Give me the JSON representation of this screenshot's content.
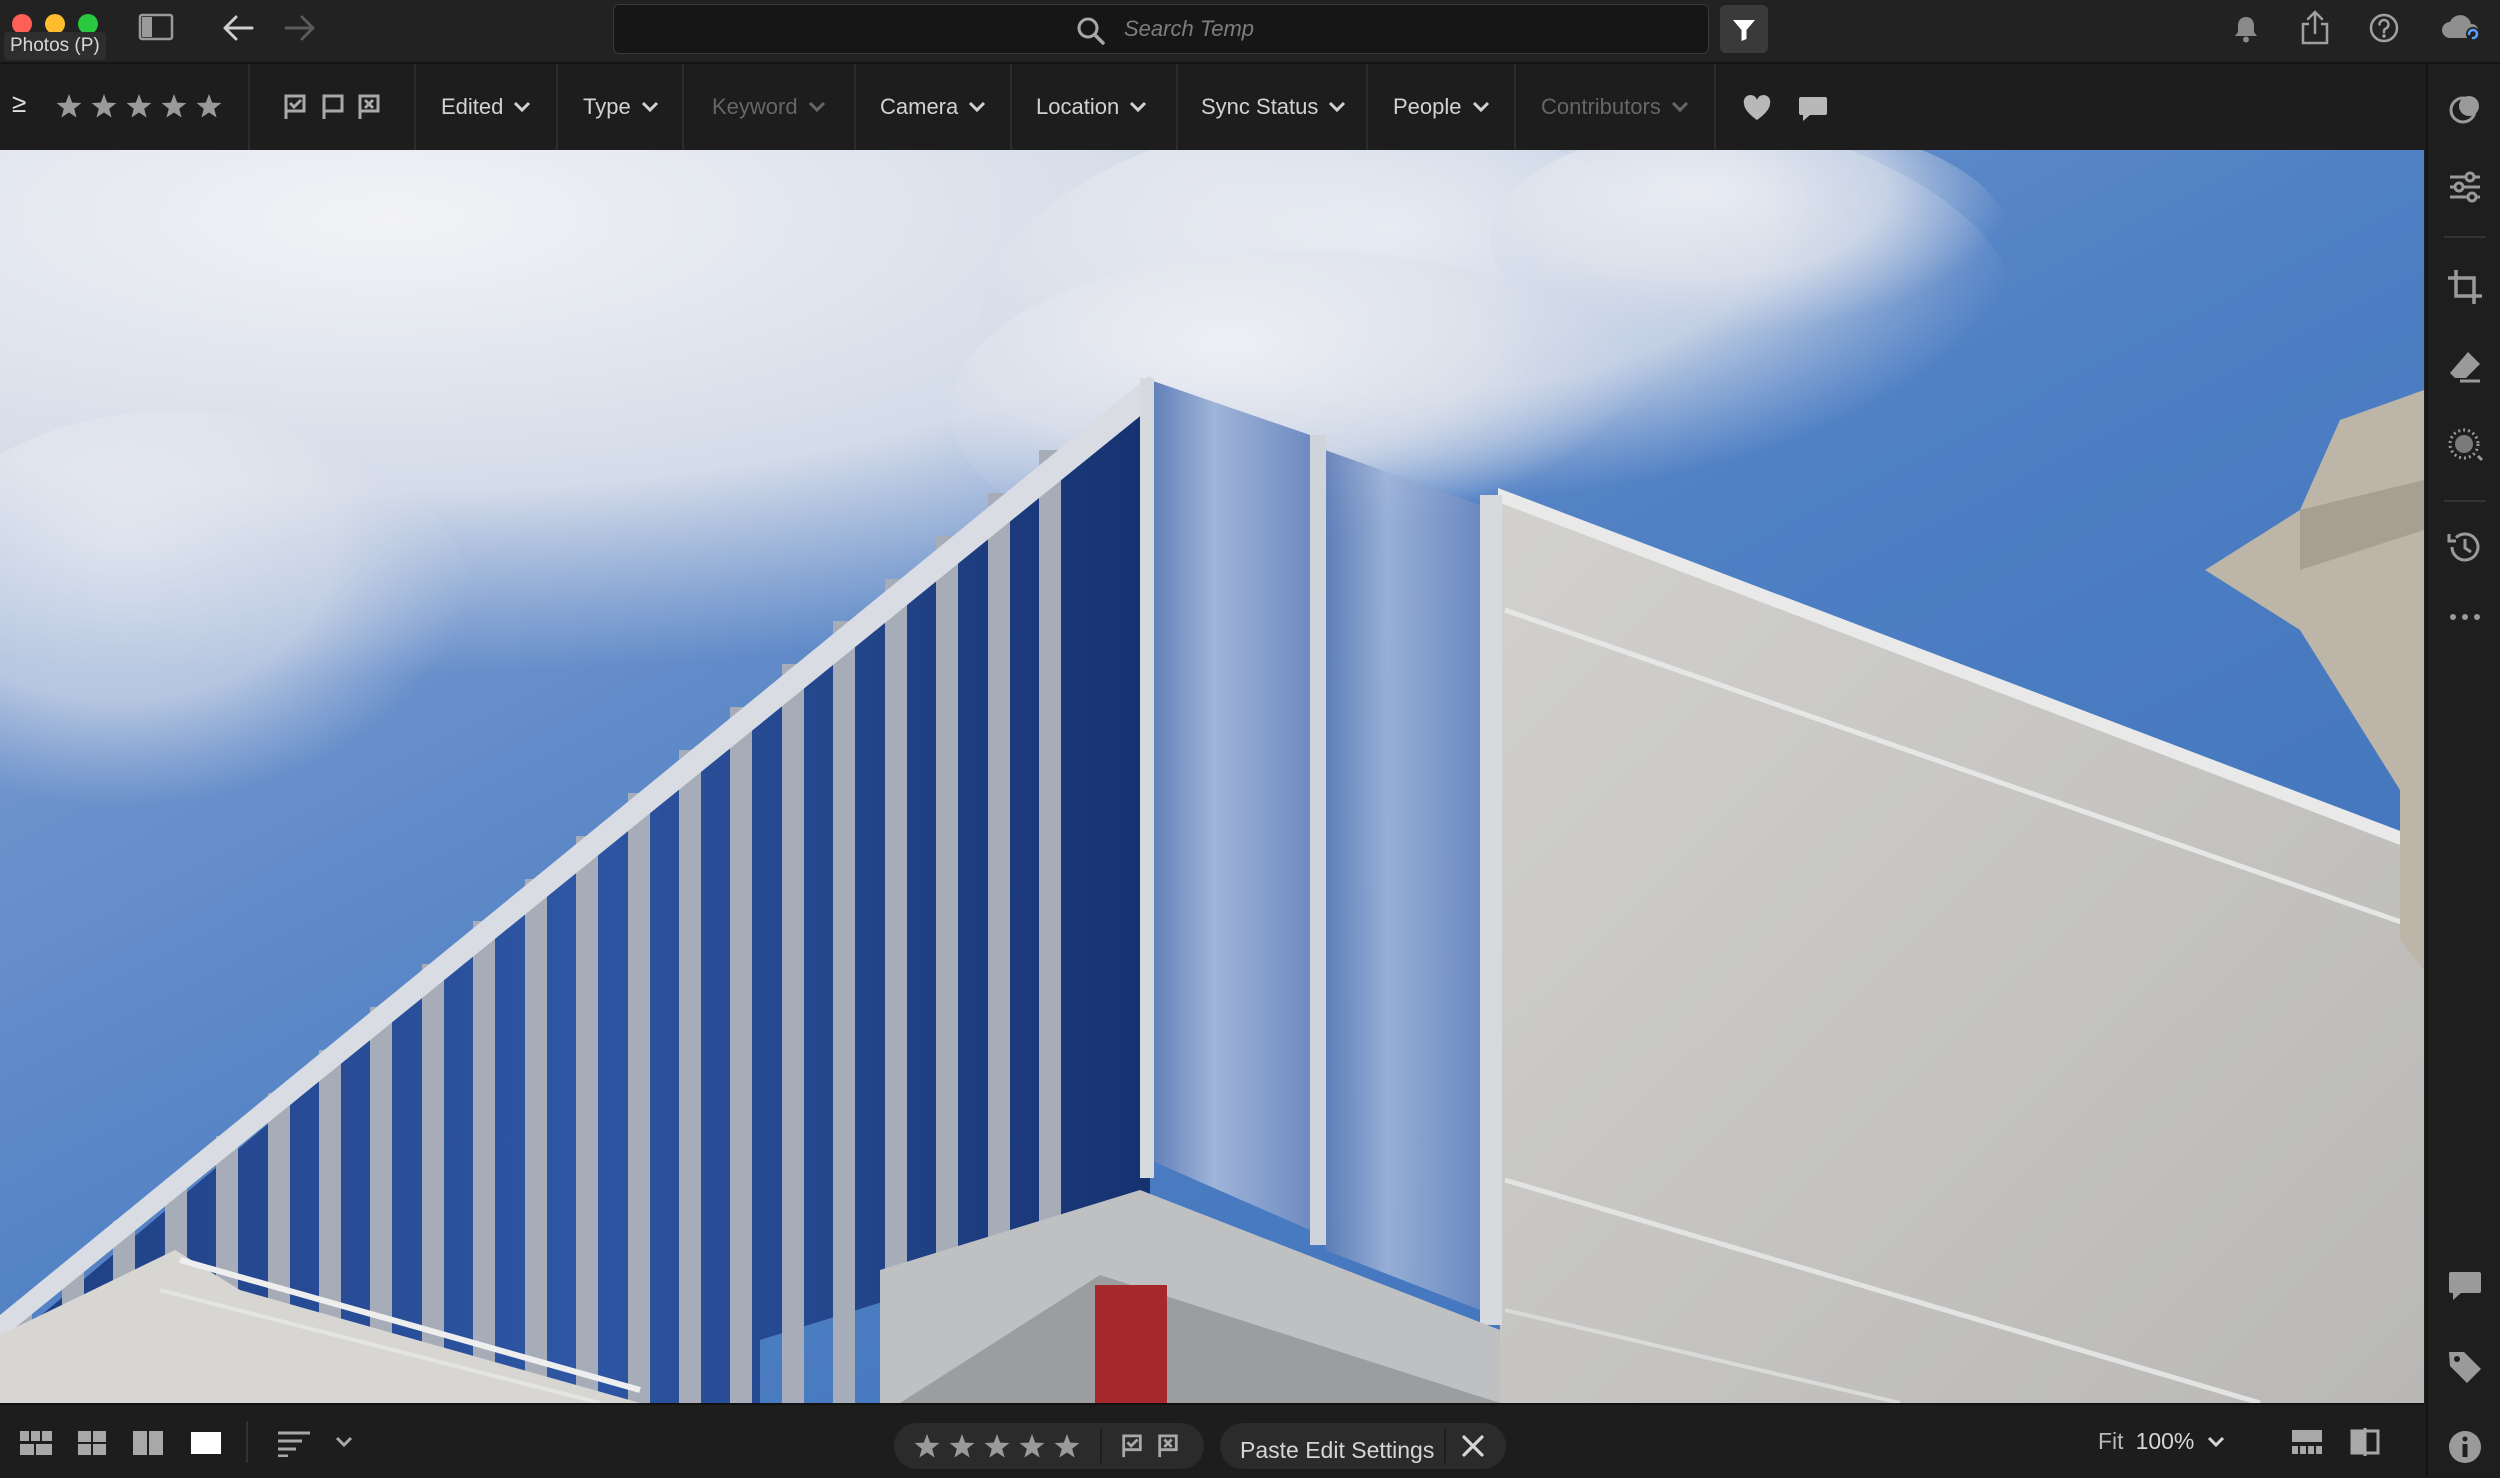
{
  "app": {
    "window_label": "Photos (P)"
  },
  "search": {
    "placeholder": "Search Temp",
    "value": ""
  },
  "filters": {
    "compare_operator": "≥",
    "star_count": 5,
    "dropdowns": [
      {
        "label": "Edited",
        "enabled": true
      },
      {
        "label": "Type",
        "enabled": true
      },
      {
        "label": "Keyword",
        "enabled": false
      },
      {
        "label": "Camera",
        "enabled": true
      },
      {
        "label": "Location",
        "enabled": true
      },
      {
        "label": "Sync Status",
        "enabled": true
      },
      {
        "label": "People",
        "enabled": true
      },
      {
        "label": "Contributors",
        "enabled": false
      }
    ]
  },
  "bottom": {
    "paste_label": "Paste Edit Settings",
    "fit_label": "Fit",
    "zoom_label": "100%"
  },
  "colors": {
    "accent": "#5aa0ff",
    "traffic_close": "#ff5f57",
    "traffic_min": "#febc2e",
    "traffic_max": "#28c840",
    "sky": "#4d7fc6",
    "wall": "#c4c3c0"
  },
  "icons": {
    "titlebar": [
      "sidebar-toggle-icon",
      "back-arrow-icon",
      "forward-arrow-icon",
      "search-icon",
      "filter-funnel-icon",
      "bell-icon",
      "share-icon",
      "help-icon",
      "cloud-sync-icon"
    ],
    "rightrail": [
      "presets-icon",
      "edit-sliders-icon",
      "crop-icon",
      "healing-eraser-icon",
      "masking-icon",
      "history-icon",
      "more-icon",
      "comment-icon",
      "keyword-tag-icon",
      "info-icon"
    ]
  }
}
